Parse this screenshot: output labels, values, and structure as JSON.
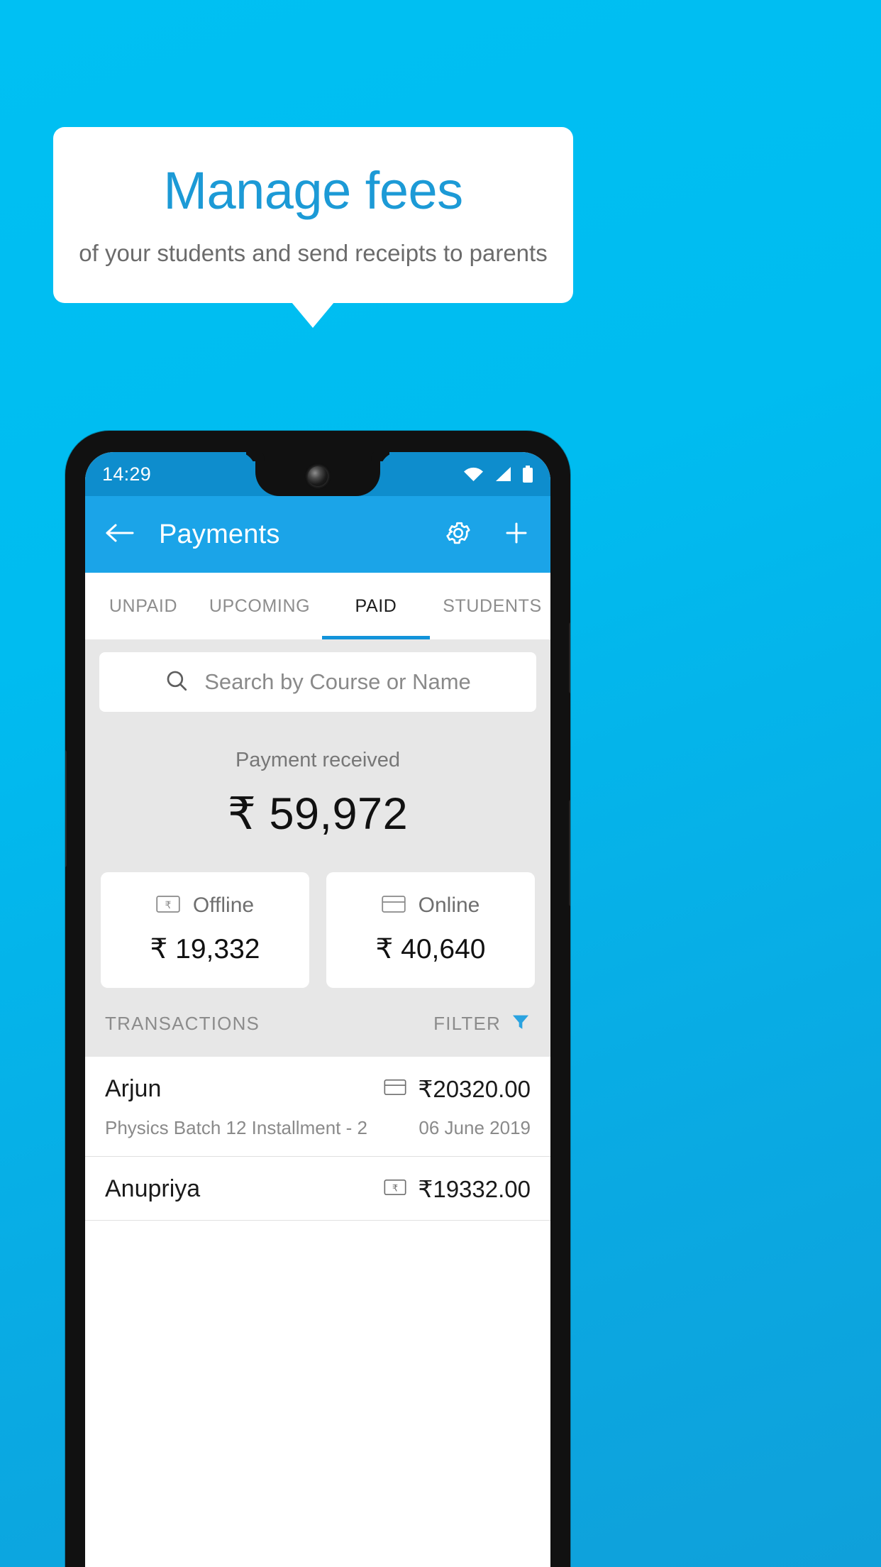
{
  "promo": {
    "title": "Manage fees",
    "subtitle": "of your students and send receipts to parents",
    "title_color": "#1c9ad6",
    "background_color": "#00bdf2"
  },
  "phone": {
    "status_bar": {
      "time": "14:29",
      "icons": [
        "wifi-icon",
        "signal-icon",
        "battery-icon"
      ],
      "background_color": "#0e8dcd"
    },
    "app_bar": {
      "back_icon": "arrow-left-icon",
      "title": "Payments",
      "settings_icon": "gear-icon",
      "add_icon": "plus-icon",
      "background_color": "#1ba4e8"
    },
    "tabs": [
      {
        "label": "UNPAID",
        "active": false
      },
      {
        "label": "UPCOMING",
        "active": false
      },
      {
        "label": "PAID",
        "active": true
      },
      {
        "label": "STUDENTS",
        "active": false
      }
    ],
    "search": {
      "icon": "search-icon",
      "placeholder": "Search by Course or Name",
      "value": ""
    },
    "summary": {
      "label": "Payment received",
      "amount": "₹ 59,972"
    },
    "method_cards": [
      {
        "icon": "banknote-rupee-icon",
        "label": "Offline",
        "amount": "₹ 19,332"
      },
      {
        "icon": "credit-card-icon",
        "label": "Online",
        "amount": "₹ 40,640"
      }
    ],
    "transactions_header": {
      "title": "TRANSACTIONS",
      "filter_label": "FILTER",
      "filter_icon": "funnel-icon",
      "filter_color": "#2aa3e0"
    },
    "transactions": [
      {
        "name": "Arjun",
        "description": "Physics Batch 12 Installment - 2",
        "amount": "₹20320.00",
        "date": "06 June 2019",
        "method_icon": "credit-card-icon"
      },
      {
        "name": "Anupriya",
        "description": "",
        "amount": "₹19332.00",
        "date": "",
        "method_icon": "banknote-rupee-icon"
      }
    ]
  }
}
